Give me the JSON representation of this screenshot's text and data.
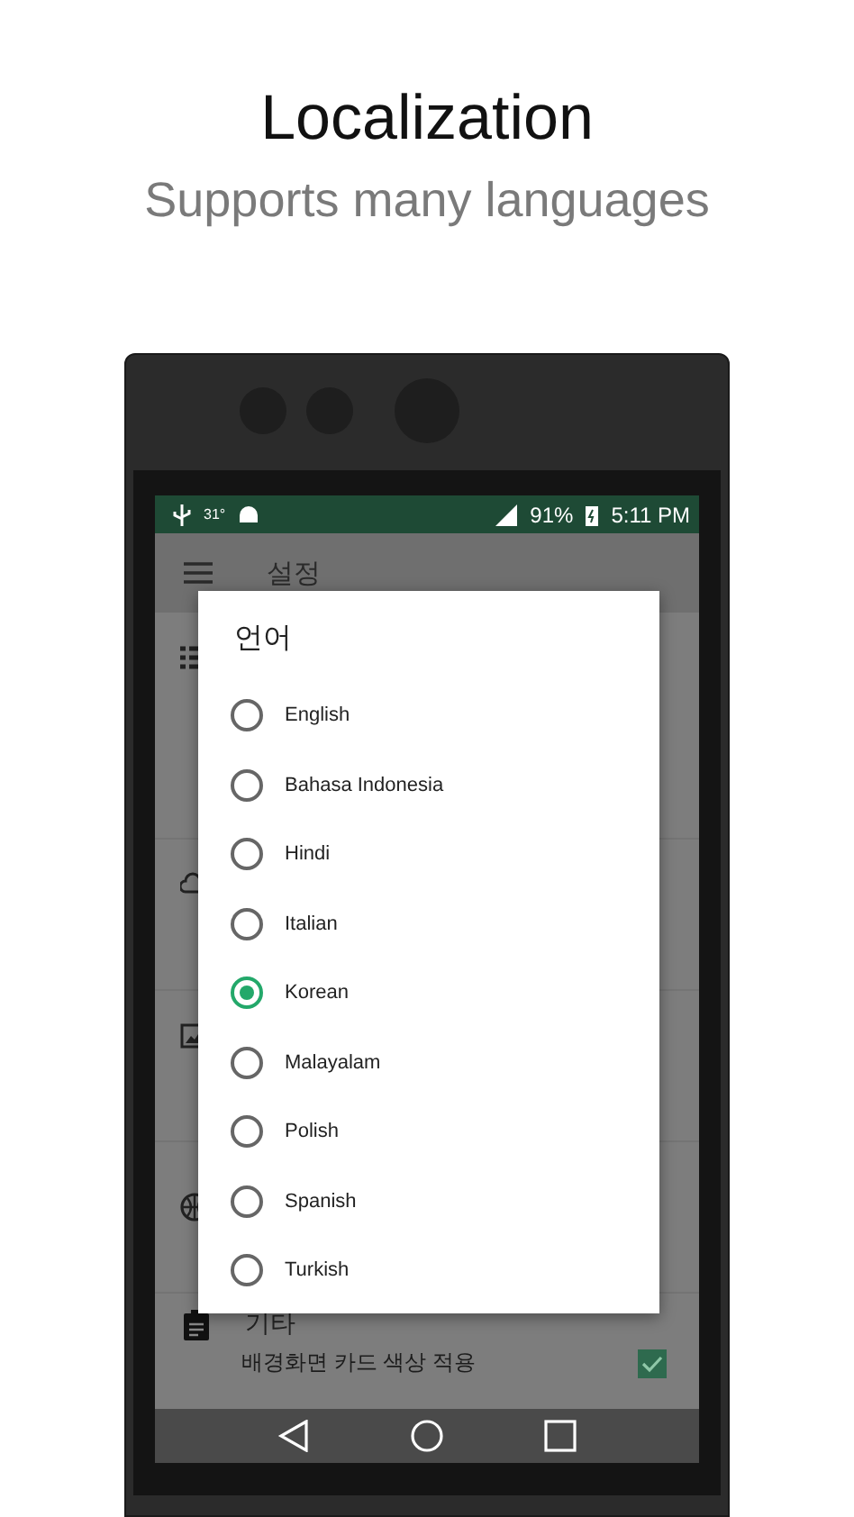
{
  "header": {
    "title": "Localization",
    "subtitle": "Supports many languages"
  },
  "status_bar": {
    "weather_temp": "31°",
    "battery": "91%",
    "time": "5:11 PM"
  },
  "app_bar": {
    "title": "설정"
  },
  "settings": {
    "section_title": "기타",
    "item": {
      "label": "배경화면 카드 색상 적용",
      "checked": true
    }
  },
  "dialog": {
    "title": "언어",
    "options": [
      {
        "label": "English",
        "selected": false
      },
      {
        "label": "Bahasa Indonesia",
        "selected": false
      },
      {
        "label": "Hindi",
        "selected": false
      },
      {
        "label": "Italian",
        "selected": false
      },
      {
        "label": "Korean",
        "selected": true
      },
      {
        "label": "Malayalam",
        "selected": false
      },
      {
        "label": "Polish",
        "selected": false
      },
      {
        "label": "Spanish",
        "selected": false
      },
      {
        "label": "Turkish",
        "selected": false
      }
    ]
  }
}
